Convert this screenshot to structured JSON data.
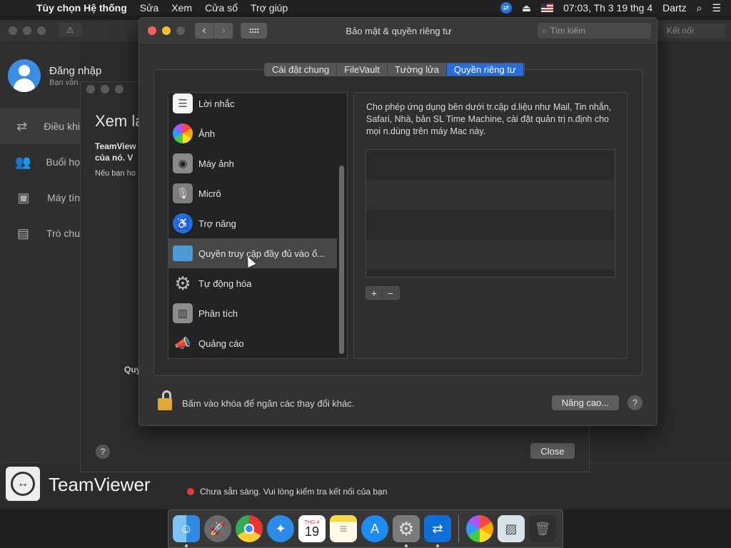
{
  "menubar": {
    "app_name": "Tùy chọn Hệ thống",
    "items": [
      "Sửa",
      "Xem",
      "Cửa sổ",
      "Trợ giúp"
    ],
    "clock": "07:03, Th 3 19 thg 4",
    "user": "Dartz"
  },
  "teamviewer": {
    "login_title": "Đăng nhập",
    "login_subtitle": "Bạn vẫn",
    "nav": [
      "Điều khi",
      "Buổi họ",
      "Máy tín",
      "Trò chu"
    ],
    "toolbar_right": "Kết nối",
    "brand": "TeamViewer",
    "status_text": "Chưa sẵn sàng. Vui lòng kiểm tra kết nối của bạn"
  },
  "mid_dialog": {
    "title": "Xem lạ",
    "bold_line1": "TeamView",
    "bold_line2": "của nó. V",
    "small_line": "Nếu bạn ho",
    "section": "Quy",
    "close_label": "Close",
    "help_label": "?"
  },
  "security": {
    "window_title": "Bảo mật & quyền riêng tư",
    "search_placeholder": "Tìm kiếm",
    "tabs": [
      "Cài đặt chung",
      "FileVault",
      "Tường lửa",
      "Quyền riêng tư"
    ],
    "active_tab": "Quyền riêng tư",
    "categories": [
      {
        "label": "Lời nhắc",
        "icon": "reminders-icon"
      },
      {
        "label": "Ảnh",
        "icon": "photos-icon"
      },
      {
        "label": "Máy ảnh",
        "icon": "camera-icon"
      },
      {
        "label": "Micrô",
        "icon": "microphone-icon"
      },
      {
        "label": "Trợ năng",
        "icon": "accessibility-icon"
      },
      {
        "label": "Quyền truy cập đầy đủ vào ổ...",
        "icon": "folder-icon"
      },
      {
        "label": "Tự động hóa",
        "icon": "gear-icon"
      },
      {
        "label": "Phân tích",
        "icon": "analytics-icon"
      },
      {
        "label": "Quảng cáo",
        "icon": "megaphone-icon"
      }
    ],
    "selected_index": 5,
    "description": "Cho phép ứng dụng bên dưới tr.cập d.liệu như Mail, Tin nhắn, Safari, Nhà, bản SL Time Machine, cài đặt quản trị n.định cho mọi n.dùng trên máy Mac này.",
    "plus_label": "+",
    "minus_label": "−",
    "lock_text": "Bấm vào khóa để ngăn các thay đổi khác.",
    "advanced_label": "Nâng cao...",
    "help_label": "?"
  },
  "dock": {
    "apps": [
      "finder-icon",
      "launchpad-icon",
      "chrome-icon",
      "safari-icon",
      "calendar-icon",
      "notes-icon",
      "app-store-icon",
      "system-preferences-icon",
      "teamviewer-icon",
      "photos-icon",
      "preview-icon",
      "trash-icon"
    ],
    "calendar_month": "THG 4",
    "calendar_day": "19"
  }
}
